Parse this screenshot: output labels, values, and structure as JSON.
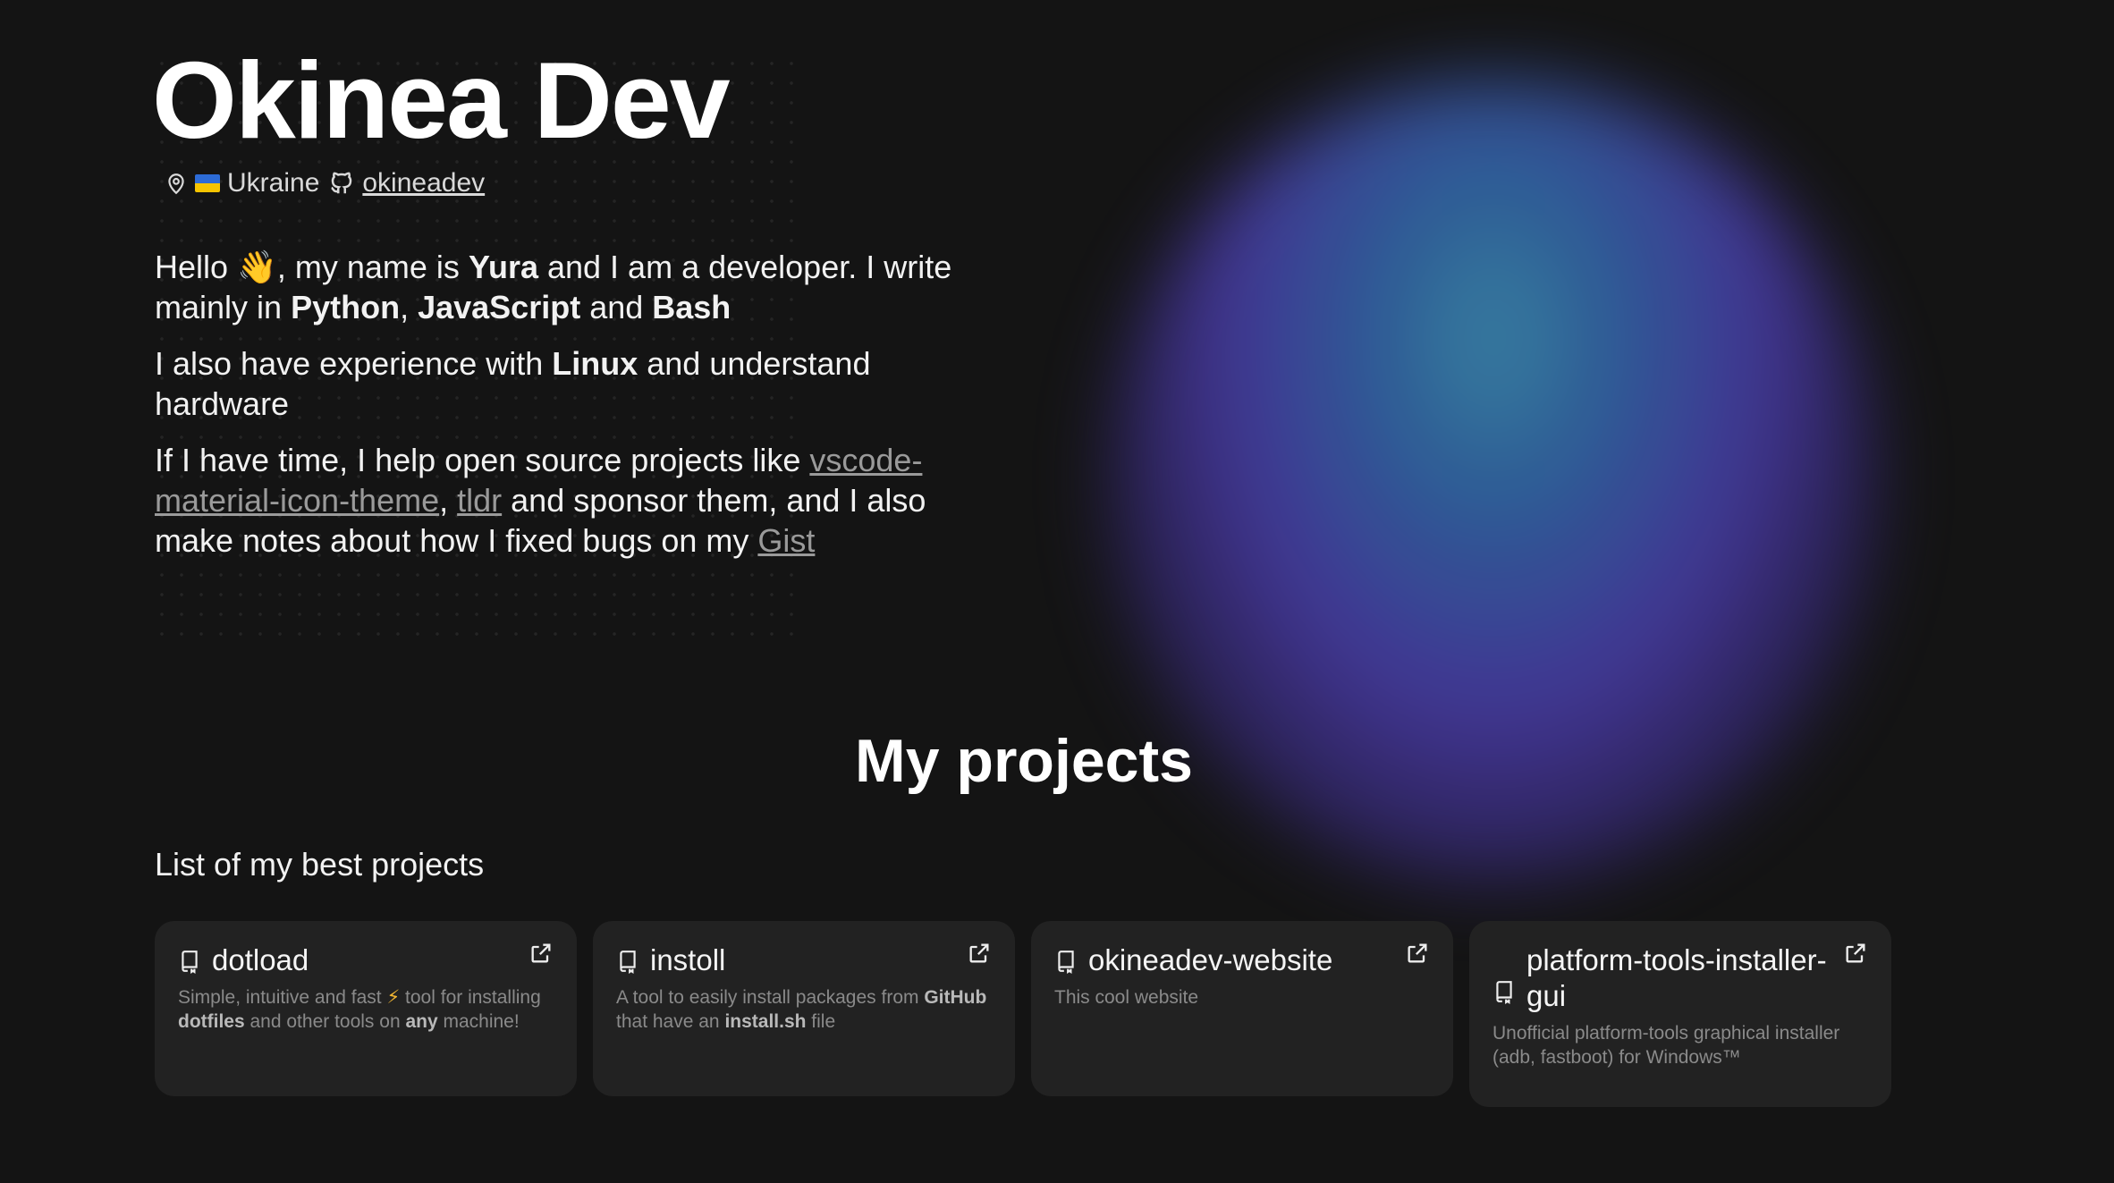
{
  "hero": {
    "title": "Okinea Dev",
    "location": "Ukraine",
    "github_handle": "okineadev"
  },
  "bio": {
    "p1": {
      "t1": "Hello ",
      "emoji": "👋",
      "t2": ", my name is ",
      "name": "Yura",
      "t3": " and I am a developer. I write mainly in ",
      "lang1": "Python",
      "t4": ", ",
      "lang2": "JavaScript",
      "t5": " and ",
      "lang3": "Bash"
    },
    "p2": {
      "t1": "I also have experience with ",
      "linux": "Linux",
      "t2": " and understand hardware"
    },
    "p3": {
      "t1": "If I have time, I help open source projects like ",
      "link1": "vscode-material-icon-theme",
      "t2": ", ",
      "link2": "tldr",
      "t3": " and sponsor them, and I also make notes about how I fixed bugs on my ",
      "link3": "Gist"
    }
  },
  "projects": {
    "title": "My projects",
    "subtitle": "List of my best projects",
    "items": [
      {
        "name": "dotload",
        "desc": {
          "t1": "Simple, intuitive and fast ",
          "emoji": "⚡",
          "t2": " tool for installing ",
          "b1": "dotfiles",
          "t3": " and other tools on ",
          "b2": "any",
          "t4": " machine!"
        }
      },
      {
        "name": "instoll",
        "desc": {
          "t1": "A tool to easily install packages from ",
          "b1": "GitHub",
          "t2": " that have an ",
          "b2": "install.sh",
          "t3": " file"
        }
      },
      {
        "name": "okineadev-website",
        "desc": {
          "t1": "This cool website"
        }
      },
      {
        "name": "platform-tools-installer-gui",
        "desc": {
          "t1": "Unofficial platform-tools graphical installer (adb, fastboot) for Windows™"
        }
      }
    ]
  },
  "colors": {
    "background": "#141414",
    "card": "#222222",
    "link": "#9a9a9a",
    "glow_blue": "#3a86a8",
    "glow_purple": "#45389a"
  },
  "icons": [
    "location-pin-icon",
    "ukraine-flag-icon",
    "github-icon",
    "repo-icon",
    "external-link-icon"
  ]
}
